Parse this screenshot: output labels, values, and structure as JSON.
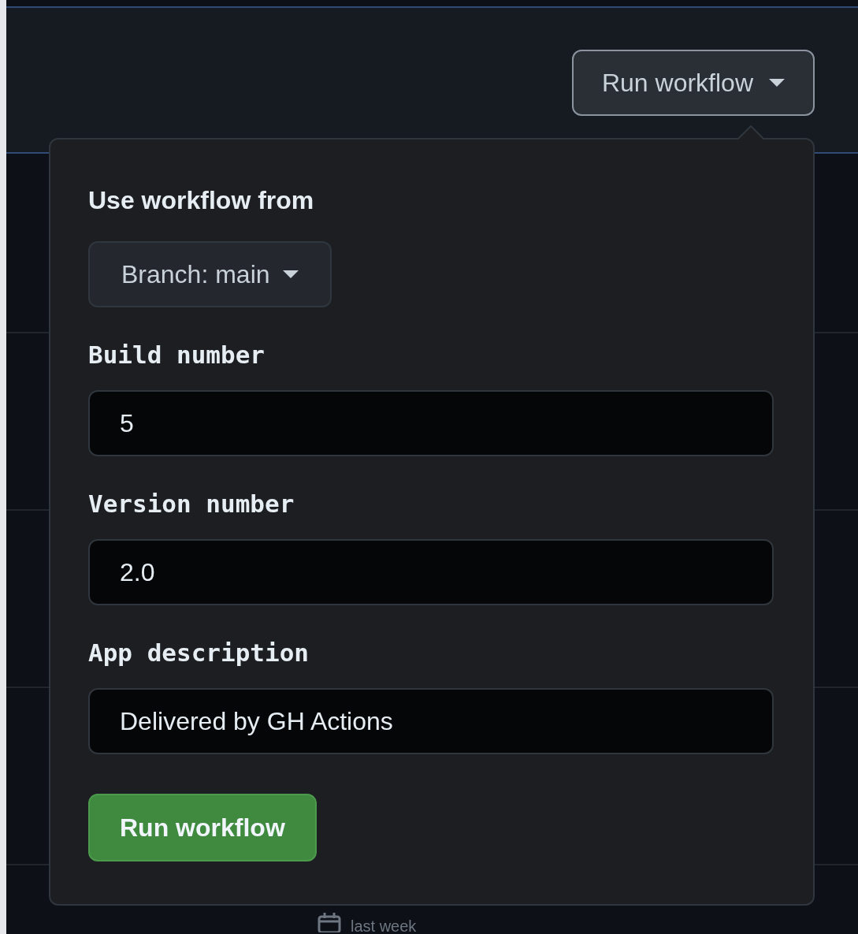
{
  "header": {
    "run_button": {
      "label": "Run workflow",
      "expanded": true
    }
  },
  "popover": {
    "title": "Use workflow from",
    "branch_button": "Branch: main",
    "inputs": [
      {
        "label": "Build number",
        "value": "5"
      },
      {
        "label": "Version number",
        "value": "2.0"
      },
      {
        "label": "App description",
        "value": "Delivered by GH Actions"
      }
    ],
    "submit": "Run workflow"
  },
  "list_row": {
    "time": "last week"
  }
}
